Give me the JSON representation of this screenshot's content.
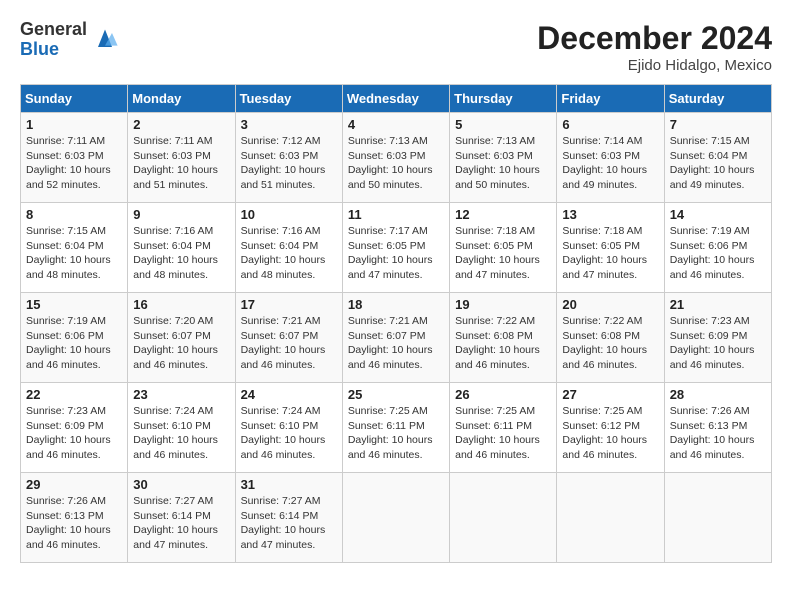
{
  "header": {
    "logo_general": "General",
    "logo_blue": "Blue",
    "month_title": "December 2024",
    "location": "Ejido Hidalgo, Mexico"
  },
  "weekdays": [
    "Sunday",
    "Monday",
    "Tuesday",
    "Wednesday",
    "Thursday",
    "Friday",
    "Saturday"
  ],
  "weeks": [
    [
      {
        "day": "1",
        "sunrise": "7:11 AM",
        "sunset": "6:03 PM",
        "daylight": "10 hours and 52 minutes."
      },
      {
        "day": "2",
        "sunrise": "7:11 AM",
        "sunset": "6:03 PM",
        "daylight": "10 hours and 51 minutes."
      },
      {
        "day": "3",
        "sunrise": "7:12 AM",
        "sunset": "6:03 PM",
        "daylight": "10 hours and 51 minutes."
      },
      {
        "day": "4",
        "sunrise": "7:13 AM",
        "sunset": "6:03 PM",
        "daylight": "10 hours and 50 minutes."
      },
      {
        "day": "5",
        "sunrise": "7:13 AM",
        "sunset": "6:03 PM",
        "daylight": "10 hours and 50 minutes."
      },
      {
        "day": "6",
        "sunrise": "7:14 AM",
        "sunset": "6:03 PM",
        "daylight": "10 hours and 49 minutes."
      },
      {
        "day": "7",
        "sunrise": "7:15 AM",
        "sunset": "6:04 PM",
        "daylight": "10 hours and 49 minutes."
      }
    ],
    [
      {
        "day": "8",
        "sunrise": "7:15 AM",
        "sunset": "6:04 PM",
        "daylight": "10 hours and 48 minutes."
      },
      {
        "day": "9",
        "sunrise": "7:16 AM",
        "sunset": "6:04 PM",
        "daylight": "10 hours and 48 minutes."
      },
      {
        "day": "10",
        "sunrise": "7:16 AM",
        "sunset": "6:04 PM",
        "daylight": "10 hours and 48 minutes."
      },
      {
        "day": "11",
        "sunrise": "7:17 AM",
        "sunset": "6:05 PM",
        "daylight": "10 hours and 47 minutes."
      },
      {
        "day": "12",
        "sunrise": "7:18 AM",
        "sunset": "6:05 PM",
        "daylight": "10 hours and 47 minutes."
      },
      {
        "day": "13",
        "sunrise": "7:18 AM",
        "sunset": "6:05 PM",
        "daylight": "10 hours and 47 minutes."
      },
      {
        "day": "14",
        "sunrise": "7:19 AM",
        "sunset": "6:06 PM",
        "daylight": "10 hours and 46 minutes."
      }
    ],
    [
      {
        "day": "15",
        "sunrise": "7:19 AM",
        "sunset": "6:06 PM",
        "daylight": "10 hours and 46 minutes."
      },
      {
        "day": "16",
        "sunrise": "7:20 AM",
        "sunset": "6:07 PM",
        "daylight": "10 hours and 46 minutes."
      },
      {
        "day": "17",
        "sunrise": "7:21 AM",
        "sunset": "6:07 PM",
        "daylight": "10 hours and 46 minutes."
      },
      {
        "day": "18",
        "sunrise": "7:21 AM",
        "sunset": "6:07 PM",
        "daylight": "10 hours and 46 minutes."
      },
      {
        "day": "19",
        "sunrise": "7:22 AM",
        "sunset": "6:08 PM",
        "daylight": "10 hours and 46 minutes."
      },
      {
        "day": "20",
        "sunrise": "7:22 AM",
        "sunset": "6:08 PM",
        "daylight": "10 hours and 46 minutes."
      },
      {
        "day": "21",
        "sunrise": "7:23 AM",
        "sunset": "6:09 PM",
        "daylight": "10 hours and 46 minutes."
      }
    ],
    [
      {
        "day": "22",
        "sunrise": "7:23 AM",
        "sunset": "6:09 PM",
        "daylight": "10 hours and 46 minutes."
      },
      {
        "day": "23",
        "sunrise": "7:24 AM",
        "sunset": "6:10 PM",
        "daylight": "10 hours and 46 minutes."
      },
      {
        "day": "24",
        "sunrise": "7:24 AM",
        "sunset": "6:10 PM",
        "daylight": "10 hours and 46 minutes."
      },
      {
        "day": "25",
        "sunrise": "7:25 AM",
        "sunset": "6:11 PM",
        "daylight": "10 hours and 46 minutes."
      },
      {
        "day": "26",
        "sunrise": "7:25 AM",
        "sunset": "6:11 PM",
        "daylight": "10 hours and 46 minutes."
      },
      {
        "day": "27",
        "sunrise": "7:25 AM",
        "sunset": "6:12 PM",
        "daylight": "10 hours and 46 minutes."
      },
      {
        "day": "28",
        "sunrise": "7:26 AM",
        "sunset": "6:13 PM",
        "daylight": "10 hours and 46 minutes."
      }
    ],
    [
      {
        "day": "29",
        "sunrise": "7:26 AM",
        "sunset": "6:13 PM",
        "daylight": "10 hours and 46 minutes."
      },
      {
        "day": "30",
        "sunrise": "7:27 AM",
        "sunset": "6:14 PM",
        "daylight": "10 hours and 47 minutes."
      },
      {
        "day": "31",
        "sunrise": "7:27 AM",
        "sunset": "6:14 PM",
        "daylight": "10 hours and 47 minutes."
      },
      null,
      null,
      null,
      null
    ]
  ]
}
